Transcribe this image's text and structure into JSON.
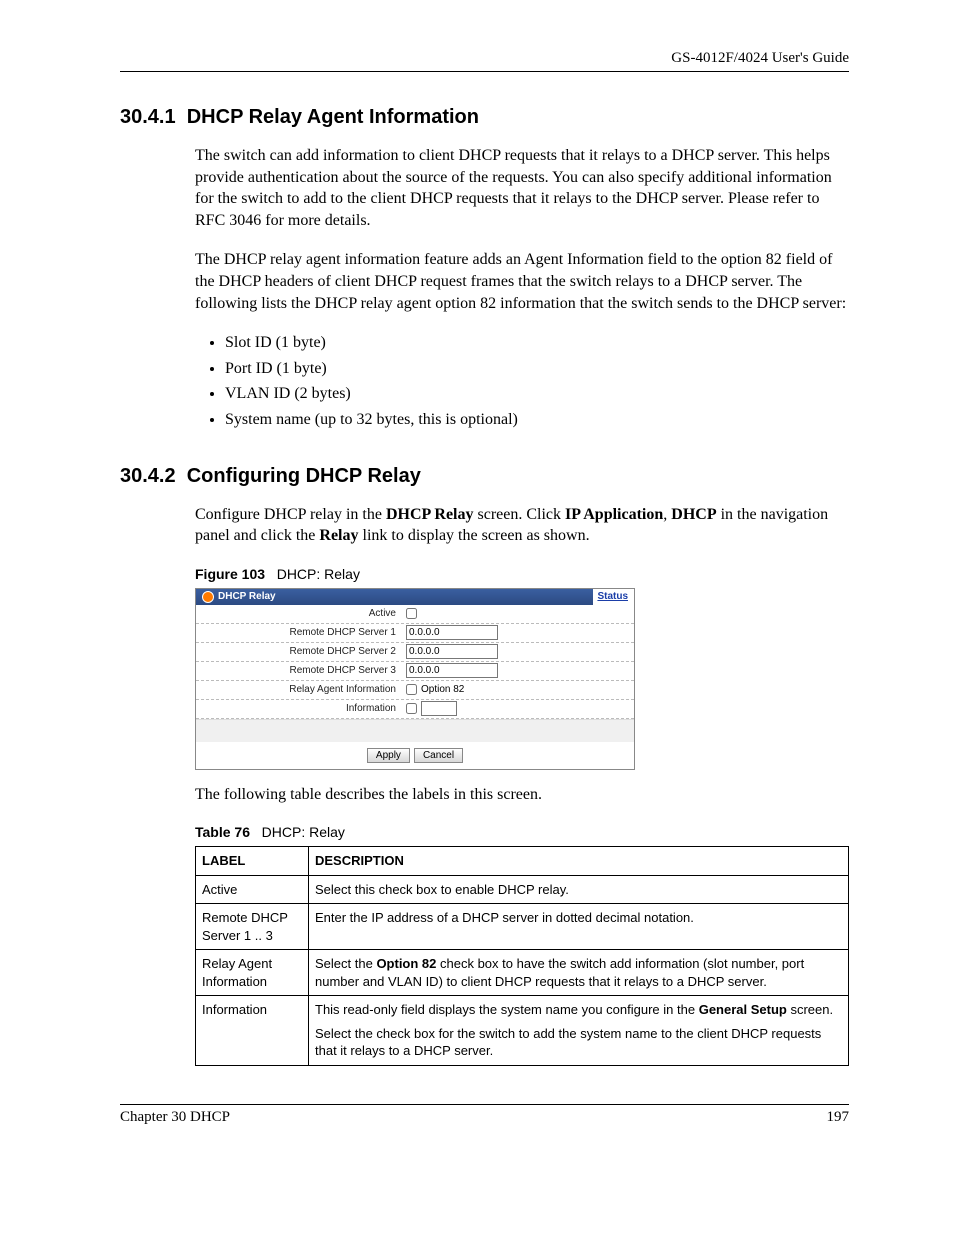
{
  "header": {
    "guide": "GS-4012F/4024 User's Guide"
  },
  "sec1": {
    "num": "30.4.1",
    "title": "DHCP Relay Agent Information",
    "p1": "The switch can add information to client DHCP requests that it relays to a DHCP server. This helps provide authentication about the source of the requests. You can also specify additional information for the switch to add to the client DHCP requests that it relays to the DHCP server. Please refer to RFC 3046 for more details.",
    "p2": "The DHCP relay agent information feature adds an Agent Information field to the option 82 field of the DHCP headers of client DHCP request frames that the switch relays to a DHCP server. The following lists the DHCP relay agent option 82 information that the switch sends to the DHCP server:",
    "bullets": [
      "Slot ID (1 byte)",
      "Port ID (1 byte)",
      "VLAN ID (2 bytes)",
      "System name (up to 32 bytes, this is optional)"
    ]
  },
  "sec2": {
    "num": "30.4.2",
    "title": "Configuring DHCP Relay",
    "p1a": "Configure DHCP relay in the ",
    "p1b": "DHCP Relay",
    "p1c": " screen. Click ",
    "p1d": "IP Application",
    "p1e": ", ",
    "p1f": "DHCP",
    "p1g": " in the navigation panel and click the ",
    "p1h": "Relay",
    "p1i": " link to display the screen as shown."
  },
  "figure": {
    "capnum": "Figure 103",
    "captxt": "DHCP: Relay",
    "title": "DHCP Relay",
    "status": "Status",
    "rows": {
      "active": "Active",
      "s1": "Remote DHCP Server 1",
      "s2": "Remote DHCP Server 2",
      "s3": "Remote DHCP Server 3",
      "rai": "Relay Agent Information",
      "rai_opt": "Option 82",
      "info": "Information"
    },
    "ip": "0.0.0.0",
    "apply": "Apply",
    "cancel": "Cancel"
  },
  "aftershot": "The following table describes the labels in this screen.",
  "table": {
    "capnum": "Table 76",
    "captxt": "DHCP: Relay",
    "h1": "LABEL",
    "h2": "DESCRIPTION",
    "r1l": "Active",
    "r1d": "Select this check box to enable DHCP relay.",
    "r2l": "Remote DHCP Server 1 .. 3",
    "r2d": "Enter the IP address of a DHCP server in dotted decimal notation.",
    "r3l": "Relay Agent Information",
    "r3d_a": "Select the ",
    "r3d_b": "Option 82",
    "r3d_c": " check box to have the switch add information (slot number, port number and VLAN ID) to client DHCP requests that it relays to a DHCP server.",
    "r4l": "Information",
    "r4d1_a": "This read-only field displays the system name you configure in the ",
    "r4d1_b": "General Setup",
    "r4d1_c": " screen.",
    "r4d2": "Select the check box for the switch to add the system name to the client DHCP requests that it relays to a DHCP server."
  },
  "footer": {
    "left": "Chapter 30 DHCP",
    "right": "197"
  }
}
